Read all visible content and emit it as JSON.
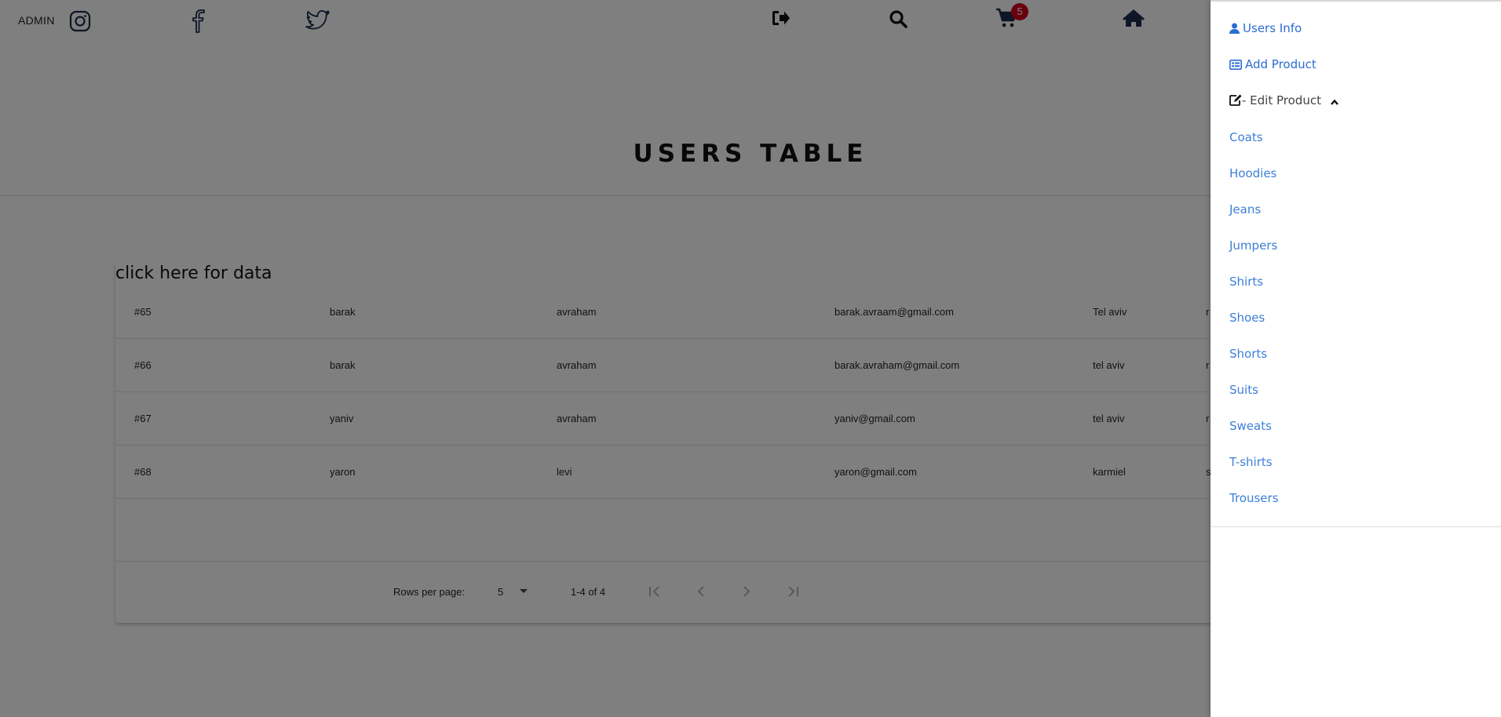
{
  "header": {
    "admin_label": "ADMIN",
    "cart_count": "5",
    "icons": [
      "instagram-icon",
      "facebook-icon",
      "twitter-icon",
      "logout-icon",
      "search-icon",
      "cart-icon",
      "home-icon"
    ]
  },
  "page": {
    "title": "USERS TABLE"
  },
  "table": {
    "caption": "click here for data",
    "rows": [
      {
        "id": "#65",
        "first": "barak",
        "last": "avraham",
        "email": "barak.avraam@gmail.com",
        "city": "Tel aviv",
        "extra": "r"
      },
      {
        "id": "#66",
        "first": "barak",
        "last": "avraham",
        "email": "barak.avraham@gmail.com",
        "city": "tel aviv",
        "extra": "r"
      },
      {
        "id": "#67",
        "first": "yaniv",
        "last": "avraham",
        "email": "yaniv@gmail.com",
        "city": "tel aviv",
        "extra": "r"
      },
      {
        "id": "#68",
        "first": "yaron",
        "last": "levi",
        "email": "yaron@gmail.com",
        "city": "karmiel",
        "extra": "s"
      }
    ],
    "pagination": {
      "rows_per_page_label": "Rows per page:",
      "rows_per_page_value": "5",
      "range": "1-4 of 4"
    }
  },
  "drawer": {
    "users_info": "Users Info",
    "add_product": "Add Product",
    "edit_product": "- Edit Product",
    "categories": [
      "Coats",
      "Hoodies",
      "Jeans",
      "Jumpers",
      "Shirts",
      "Shoes",
      "Shorts",
      "Suits",
      "Sweats",
      "T-shirts",
      "Trousers"
    ]
  },
  "colors": {
    "link_blue": "#2b6cd4",
    "icon_navy": "#1c2b4a",
    "badge_red": "#d0021b"
  }
}
